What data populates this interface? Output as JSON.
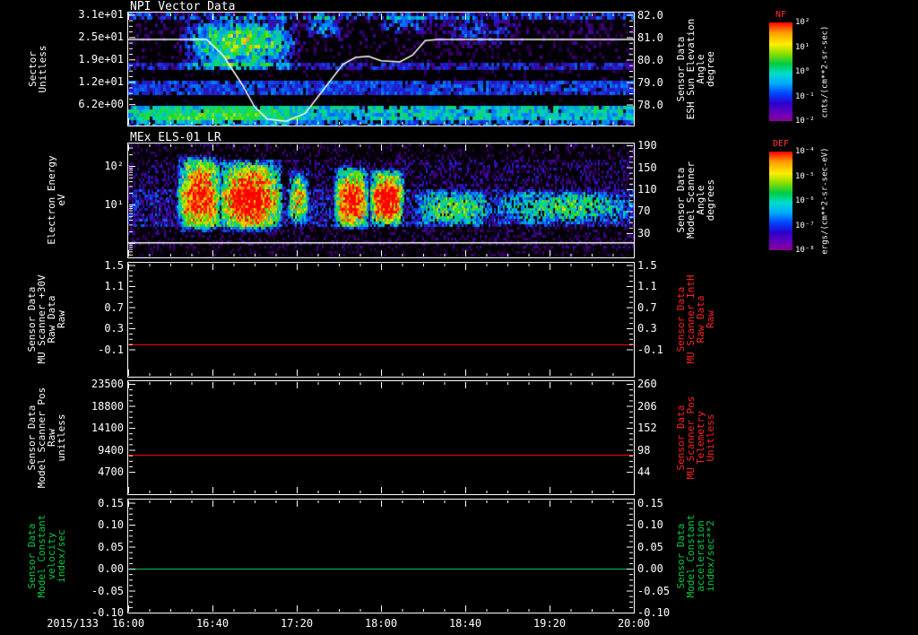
{
  "x_axis": {
    "date_label": "2015/133",
    "tick_labels": [
      "16:00",
      "16:40",
      "17:20",
      "18:00",
      "18:40",
      "19:20",
      "20:00"
    ],
    "range_hours": [
      16,
      20
    ]
  },
  "chart_data": [
    {
      "type": "heatmap",
      "title": "NPI Vector Data",
      "x_range_hours": [
        16,
        20
      ],
      "y_axis_left": {
        "label": "Sector\nUnitless",
        "scale": "linear",
        "range": [
          31.59,
          0.28
        ],
        "tick_values": [
          31,
          24.8,
          18.6,
          12.4,
          6.2
        ],
        "tick_labels": [
          "3.1e+01",
          "2.5e+01",
          "1.9e+01",
          "1.2e+01",
          "6.2e+00"
        ]
      },
      "y_axis_right": {
        "label": "Sensor Data\nESH Sun Elevation\nAngle\ndegree",
        "scale": "linear",
        "range": [
          82.1,
          77.06
        ],
        "tick_values": [
          82,
          81,
          80,
          79,
          78
        ],
        "tick_labels": [
          "82.0",
          "81.0",
          "80.0",
          "79.0",
          "78.0"
        ]
      },
      "colorbar": {
        "title": "NF",
        "units": "cnts/(cm**2-sr-sec)",
        "tick_labels": [
          "10²",
          "10¹",
          "10⁰",
          "10⁻¹",
          "10⁻²"
        ]
      },
      "overlay_line": {
        "name": "ESH Sun Elevation Angle",
        "color": "#ffffff",
        "axis": "right",
        "points": [
          [
            16.0,
            80.9
          ],
          [
            16.62,
            80.9
          ],
          [
            16.75,
            80.2
          ],
          [
            16.9,
            78.9
          ],
          [
            17.0,
            77.9
          ],
          [
            17.1,
            77.35
          ],
          [
            17.25,
            77.25
          ],
          [
            17.4,
            77.6
          ],
          [
            17.55,
            78.7
          ],
          [
            17.7,
            79.8
          ],
          [
            17.8,
            80.1
          ],
          [
            17.9,
            80.15
          ],
          [
            18.0,
            79.95
          ],
          [
            18.15,
            79.9
          ],
          [
            18.25,
            80.2
          ],
          [
            18.35,
            80.85
          ],
          [
            18.45,
            80.9
          ],
          [
            20.0,
            80.9
          ]
        ]
      },
      "texture": {
        "bands": [
          {
            "y0": 0.0,
            "y1": 0.06,
            "base": 0.3,
            "noise": 0.15,
            "sparse": 0.3
          },
          {
            "y0": 0.06,
            "y1": 0.3,
            "base": 0.1,
            "noise": 0.12,
            "sparse": 0.62
          },
          {
            "y0": 0.3,
            "y1": 0.42,
            "base": 0.08,
            "noise": 0.1,
            "sparse": 0.7
          },
          {
            "y0": 0.42,
            "y1": 0.5,
            "base": 0.28,
            "noise": 0.1,
            "sparse": 0.25
          },
          {
            "y0": 0.5,
            "y1": 0.6,
            "base": 0.06,
            "noise": 0.08,
            "sparse": 0.8
          },
          {
            "y0": 0.6,
            "y1": 0.73,
            "base": 0.34,
            "noise": 0.1,
            "sparse": 0.12
          },
          {
            "y0": 0.73,
            "y1": 0.82,
            "base": 0.04,
            "noise": 0.05,
            "sparse": 0.85
          },
          {
            "y0": 0.82,
            "y1": 0.94,
            "base": 0.5,
            "noise": 0.1,
            "sparse": 0.05
          },
          {
            "y0": 0.94,
            "y1": 1.01,
            "base": 0.4,
            "noise": 0.1,
            "sparse": 0.15
          }
        ],
        "blobs": [
          {
            "x0": 0.1,
            "x1": 0.34,
            "y0": 0.02,
            "y1": 0.5,
            "boost": 0.55
          },
          {
            "x0": 0.14,
            "x1": 0.28,
            "y0": 0.05,
            "y1": 0.35,
            "boost": 0.3
          },
          {
            "x0": 0.35,
            "x1": 0.42,
            "y0": 0.0,
            "y1": 0.22,
            "boost": 0.35
          },
          {
            "x0": 0.49,
            "x1": 0.6,
            "y0": 0.0,
            "y1": 0.18,
            "boost": 0.3
          },
          {
            "x0": 0.6,
            "x1": 0.78,
            "y0": 0.02,
            "y1": 0.28,
            "boost": 0.22
          },
          {
            "x0": 0.0,
            "x1": 0.35,
            "y0": 0.82,
            "y1": 1.0,
            "boost": 0.12
          }
        ]
      }
    },
    {
      "type": "heatmap",
      "title": "MEx ELS-01 LR",
      "x_range_hours": [
        16,
        20
      ],
      "y_axis_left": {
        "label": "Electron Energy\neV",
        "scale": "log",
        "range": [
          383,
          0.42
        ],
        "tick_values": [
          100,
          10
        ],
        "tick_labels": [
          "10²",
          "10¹"
        ]
      },
      "y_axis_right": {
        "label": "Sensor Data\nModel Scanner\nAngle\ndegrees",
        "scale": "linear",
        "range": [
          193.3,
          -14.2
        ],
        "tick_values": [
          190,
          150,
          110,
          70,
          30
        ],
        "tick_labels": [
          "190",
          "150",
          "110",
          "70",
          "30"
        ]
      },
      "colorbar": {
        "title": "DEF",
        "units": "ergs/(cm**2-sr-sec-eV)",
        "tick_labels": [
          "10⁻⁴",
          "10⁻⁵",
          "10⁻⁶",
          "10⁻⁷",
          "10⁻⁸"
        ]
      },
      "overlay_line": {
        "name": "low energy cutoff",
        "color": "#ffffff",
        "axis": "left",
        "points": [
          [
            16.0,
            1.0
          ],
          [
            20.0,
            1.0
          ]
        ]
      },
      "texture": {
        "bands": [
          {
            "y0": 0.0,
            "y1": 0.12,
            "base": 0.1,
            "noise": 0.12,
            "sparse": 0.65
          },
          {
            "y0": 0.12,
            "y1": 0.4,
            "base": 0.16,
            "noise": 0.15,
            "sparse": 0.5
          },
          {
            "y0": 0.4,
            "y1": 0.72,
            "base": 0.26,
            "noise": 0.15,
            "sparse": 0.3
          },
          {
            "y0": 0.72,
            "y1": 0.9,
            "base": 0.12,
            "noise": 0.12,
            "sparse": 0.6
          },
          {
            "y0": 0.9,
            "y1": 1.01,
            "base": 0.08,
            "noise": 0.1,
            "sparse": 0.65
          }
        ],
        "blobs": [
          {
            "x0": 0.095,
            "x1": 0.185,
            "y0": 0.08,
            "y1": 0.78,
            "boost": 0.8
          },
          {
            "x0": 0.175,
            "x1": 0.305,
            "y0": 0.12,
            "y1": 0.78,
            "boost": 0.85
          },
          {
            "x0": 0.315,
            "x1": 0.355,
            "y0": 0.22,
            "y1": 0.7,
            "boost": 0.55
          },
          {
            "x0": 0.405,
            "x1": 0.475,
            "y0": 0.18,
            "y1": 0.75,
            "boost": 0.8
          },
          {
            "x0": 0.475,
            "x1": 0.545,
            "y0": 0.2,
            "y1": 0.72,
            "boost": 0.85
          },
          {
            "x0": 0.565,
            "x1": 0.72,
            "y0": 0.4,
            "y1": 0.72,
            "boost": 0.38
          },
          {
            "x0": 0.72,
            "x1": 1.0,
            "y0": 0.4,
            "y1": 0.7,
            "boost": 0.32
          }
        ]
      }
    },
    {
      "type": "line",
      "y_axis_left": {
        "label": "Sensor Data\nMU Scanner +30V\nRaw Data\nRaw",
        "label_color": "#ffffff",
        "scale": "linear",
        "range": [
          1.543,
          -0.619
        ],
        "tick_values": [
          1.5,
          1.1,
          0.7,
          0.3,
          -0.1
        ],
        "tick_labels": [
          "1.5",
          "1.1",
          "0.7",
          "0.3",
          "-0.1"
        ]
      },
      "y_axis_right": {
        "label": "Sensor Data\nMU Scanner IntH\nRaw Data\nRaw",
        "label_color": "#ff2222",
        "scale": "linear",
        "range": [
          1.543,
          -0.619
        ],
        "tick_values": [
          1.5,
          1.1,
          0.7,
          0.3,
          -0.1
        ],
        "tick_labels": [
          "1.5",
          "1.1",
          "0.7",
          "0.3",
          "-0.1"
        ]
      },
      "series": [
        {
          "name": "MU Scanner +30V Raw Data",
          "axis": "left",
          "color": "#ff0000",
          "value": 0.0
        },
        {
          "name": "MU Scanner IntH Raw Data",
          "axis": "right",
          "color": "#ff0000",
          "value": 0.0
        }
      ]
    },
    {
      "type": "line",
      "y_axis_left": {
        "label": "Sensor Data\nModel Scanner Pos\nRaw\nunitless",
        "label_color": "#ffffff",
        "scale": "linear",
        "range": [
          24080,
          -85
        ],
        "tick_values": [
          23500,
          18800,
          14100,
          9400,
          4700
        ],
        "tick_labels": [
          "23500",
          "18800",
          "14100",
          "9400",
          "4700"
        ]
      },
      "y_axis_right": {
        "label": "Sensor Data\nMU Scanner Pos\nTelemetry\nUnitless",
        "label_color": "#ff2222",
        "scale": "linear",
        "range": [
          266.7,
          -10.9
        ],
        "tick_values": [
          260,
          206,
          152,
          98,
          44
        ],
        "tick_labels": [
          "260",
          "206",
          "152",
          "98",
          "44"
        ]
      },
      "series": [
        {
          "name": "Model Scanner Pos Raw",
          "axis": "left",
          "color": "#ff0000",
          "value": 8300
        },
        {
          "name": "MU Scanner Pos Telemetry",
          "axis": "right",
          "color": "#ff0000",
          "value": 86
        }
      ]
    },
    {
      "type": "line",
      "y_axis_left": {
        "label": "Sensor Data\nModel Constant\nvelocity\nindex/sec",
        "label_color": "#00cc44",
        "scale": "linear",
        "range": [
          0.1572,
          -0.1
        ],
        "tick_values": [
          0.15,
          0.1,
          0.05,
          0.0,
          -0.05,
          -0.1
        ],
        "tick_labels": [
          "0.15",
          "0.10",
          "0.05",
          "0.00",
          "-0.05",
          "-0.10"
        ]
      },
      "y_axis_right": {
        "label": "Sensor Data\nModel Constant\nacceleration\nindex/sec**2",
        "label_color": "#00cc44",
        "scale": "linear",
        "range": [
          0.1572,
          -0.1
        ],
        "tick_values": [
          0.15,
          0.1,
          0.05,
          0.0,
          -0.05,
          -0.1
        ],
        "tick_labels": [
          "0.15",
          "0.10",
          "0.05",
          "0.00",
          "-0.05",
          "-0.10"
        ]
      },
      "series": [
        {
          "name": "Model Constant velocity",
          "axis": "left",
          "color": "#00cc44",
          "value": 0.0
        },
        {
          "name": "Model Constant acceleration",
          "axis": "right",
          "color": "#00cc44",
          "value": 0.0
        }
      ]
    }
  ]
}
